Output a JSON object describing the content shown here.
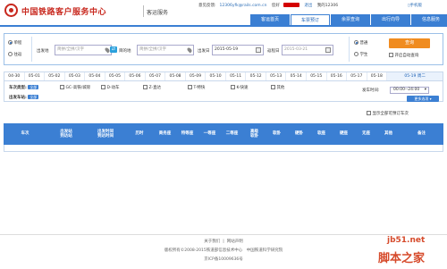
{
  "header": {
    "title": "中国铁路客户服务中心",
    "subtitle": "客运服务",
    "feedback_label": "意见反馈:",
    "email": "12306yfk@rails.com.cn",
    "greeting": "您好",
    "logout": "退出",
    "my12306": "我的12306",
    "mobile": "手机版"
  },
  "nav": [
    "客运首页",
    "车票预订",
    "余票查询",
    "出行向导",
    "信息服务"
  ],
  "search": {
    "one_way": "单程",
    "round_trip": "往返",
    "from_label": "出发地",
    "from_placeholder": "简拼/全拼/汉字",
    "to_label": "目的地",
    "to_placeholder": "简拼/全拼/汉字",
    "depart_label": "出发日",
    "depart_value": "2015-05-19",
    "return_label": "返程日",
    "return_value": "2015-03-21",
    "normal": "普通",
    "student": "学生",
    "query_button": "查询",
    "auto_query": "开启自动查询"
  },
  "dates": [
    "04-30",
    "05-01",
    "05-02",
    "05-03",
    "05-04",
    "05-05",
    "05-06",
    "05-07",
    "05-08",
    "05-09",
    "05-10",
    "05-11",
    "05-12",
    "05-13",
    "05-14",
    "05-15",
    "05-16",
    "05-17",
    "05-18"
  ],
  "selected_date": "05-19 周二",
  "filters": {
    "train_type_label": "车次类型:",
    "all": "全部",
    "types": [
      "GC-高铁/城际",
      "D-动车",
      "Z-直达",
      "T-特快",
      "K-快速",
      "其他"
    ],
    "station_label": "出发车站:",
    "time_label": "发车时间:",
    "time_value": "00:00--24:00",
    "more_button": "更多选项 ▾"
  },
  "show_all_label": "显示全部可预订车次",
  "table_headers": [
    "车次",
    "出发站\n到达站",
    "出发时间\n到达时间",
    "历时",
    "商务座",
    "特等座",
    "一等座",
    "二等座",
    "高级\n软卧",
    "软卧",
    "硬卧",
    "软座",
    "硬座",
    "无座",
    "其他",
    "备注"
  ],
  "footer": {
    "links": [
      "关于我们",
      "网站声明"
    ],
    "copyright": "版权所有©2008-2015铁道部信息技术中心　中国铁道科学研究院",
    "icp": "京ICP备10009636号"
  },
  "watermark": {
    "site": "jb51.net",
    "name": "脚本之家"
  }
}
